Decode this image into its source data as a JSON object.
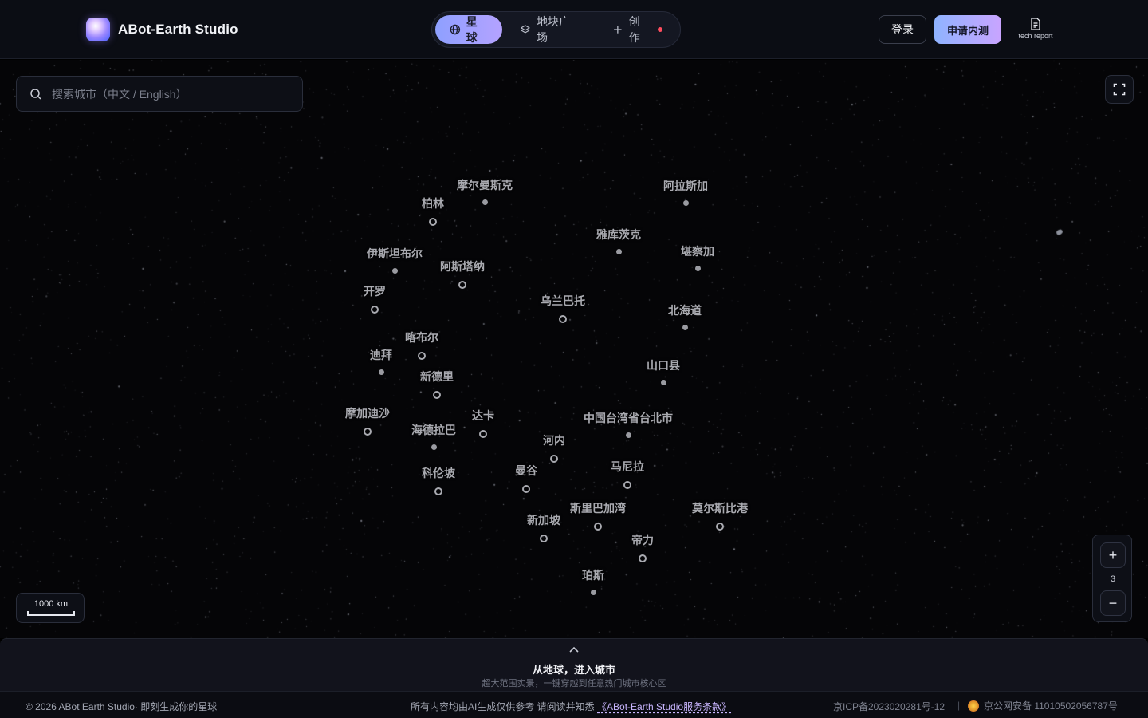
{
  "brand": {
    "name": "ABot-Earth Studio"
  },
  "nav": {
    "tabs": [
      {
        "label": "星球",
        "icon": "globe-icon",
        "active": true
      },
      {
        "label": "地块广场",
        "icon": "layers-icon",
        "active": false
      },
      {
        "label": "创作",
        "icon": "plus-icon",
        "active": false,
        "badge": "new-dot"
      }
    ]
  },
  "header": {
    "login_label": "登录",
    "apply_label": "申请内测",
    "tech_report_label": "tech report"
  },
  "search": {
    "placeholder": "搜索城市（中文 / English）",
    "value": ""
  },
  "map": {
    "cities": [
      {
        "name": "摩尔曼斯克",
        "marker": "dot"
      },
      {
        "name": "阿拉斯加",
        "marker": "dot"
      },
      {
        "name": "柏林",
        "marker": "ring"
      },
      {
        "name": "雅库茨克",
        "marker": "dot"
      },
      {
        "name": "伊斯坦布尔",
        "marker": "dot"
      },
      {
        "name": "堪察加",
        "marker": "dot"
      },
      {
        "name": "阿斯塔纳",
        "marker": "ring"
      },
      {
        "name": "开罗",
        "marker": "ring"
      },
      {
        "name": "乌兰巴托",
        "marker": "ring"
      },
      {
        "name": "北海道",
        "marker": "dot"
      },
      {
        "name": "喀布尔",
        "marker": "ring"
      },
      {
        "name": "迪拜",
        "marker": "dot"
      },
      {
        "name": "新德里",
        "marker": "ring"
      },
      {
        "name": "山口县",
        "marker": "dot"
      },
      {
        "name": "摩加迪沙",
        "marker": "ring"
      },
      {
        "name": "达卡",
        "marker": "ring"
      },
      {
        "name": "中国台湾省台北市",
        "marker": "dot"
      },
      {
        "name": "海德拉巴",
        "marker": "dot"
      },
      {
        "name": "河内",
        "marker": "ring"
      },
      {
        "name": "科伦坡",
        "marker": "ring"
      },
      {
        "name": "曼谷",
        "marker": "ring"
      },
      {
        "name": "马尼拉",
        "marker": "ring"
      },
      {
        "name": "斯里巴加湾",
        "marker": "ring"
      },
      {
        "name": "莫尔斯比港",
        "marker": "ring"
      },
      {
        "name": "新加坡",
        "marker": "ring"
      },
      {
        "name": "帝力",
        "marker": "ring"
      },
      {
        "name": "珀斯",
        "marker": "dot"
      }
    ],
    "scale_label": "1000 km",
    "zoom_level": "3",
    "zoom_in_label": "+",
    "zoom_out_label": "−"
  },
  "promo": {
    "title": "从地球，进入城市",
    "subtitle": "超大范围实景，一键穿越到任意热门城市核心区"
  },
  "footer": {
    "copyright": "© 2026 ABot Earth Studio· 即刻生成你的星球",
    "notice": "所有内容均由AI生成仅供参考 请阅读并知悉 ",
    "terms_link": "《ABot-Earth Studio服务条款》",
    "icp": "京ICP备2023020281号-12",
    "separator": "|",
    "police": "京公网安备 11010502056787号"
  },
  "colors": {
    "accent_start": "#8ea0ff",
    "accent_end": "#c9a4ff",
    "background": "#050507",
    "new_dot": "#ff4d5e"
  }
}
